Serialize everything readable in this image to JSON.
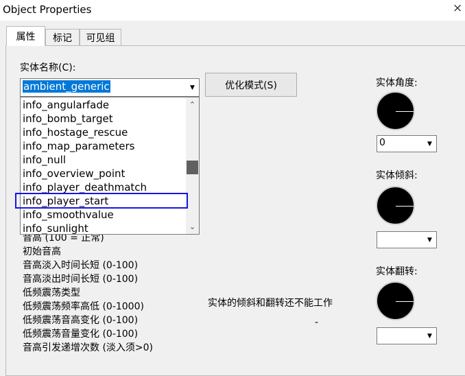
{
  "window": {
    "title": "Object Properties",
    "close_glyph": "×"
  },
  "tabs": [
    {
      "label": "属性",
      "active": true
    },
    {
      "label": "标记",
      "active": false
    },
    {
      "label": "可见组",
      "active": false
    }
  ],
  "entity_name": {
    "label": "实体名称(C):",
    "value": "ambient_generic"
  },
  "optimize_button": {
    "label": "优化模式(S)"
  },
  "dropdown": {
    "items": [
      "info_angularfade",
      "info_bomb_target",
      "info_hostage_rescue",
      "info_map_parameters",
      "info_null",
      "info_overview_point",
      "info_player_deathmatch",
      "info_player_start",
      "info_smoothvalue",
      "info_sunlight"
    ],
    "highlighted": "info_player_start"
  },
  "property_list": [
    "音高 (100 = 正常)",
    "初始音高",
    "音高淡入时间长短 (0-100)",
    "音高淡出时间长短 (0-100)",
    "低频震荡类型",
    "低频震荡频率高低 (0-1000)",
    "低频震荡音高变化 (0-100)",
    "低频震荡音量变化 (0-100)",
    "音高引发递增次数 (淡入须>0)"
  ],
  "angle": {
    "label": "实体角度:",
    "value": "0"
  },
  "pitch": {
    "label": "实体倾斜:",
    "value": ""
  },
  "roll": {
    "label": "实体翻转:",
    "value": ""
  },
  "notice": "实体的倾斜和翻转还不能工作",
  "notice_dash": "-"
}
